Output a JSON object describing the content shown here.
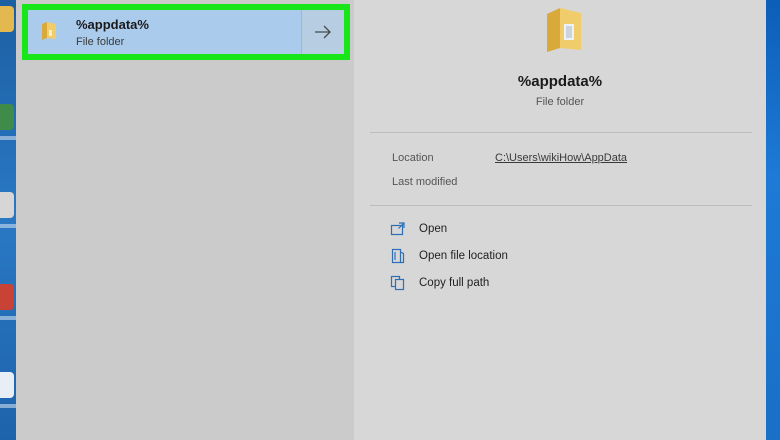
{
  "search_result": {
    "title": "%appdata%",
    "subtitle": "File folder"
  },
  "preview": {
    "title": "%appdata%",
    "subtitle": "File folder",
    "details": [
      {
        "label": "Location",
        "value": "C:\\Users\\wikiHow\\AppData"
      },
      {
        "label": "Last modified",
        "value": ""
      }
    ],
    "actions": [
      {
        "label": "Open",
        "icon": "open-icon"
      },
      {
        "label": "Open file location",
        "icon": "open-file-location-icon"
      },
      {
        "label": "Copy full path",
        "icon": "copy-full-path-icon"
      }
    ]
  },
  "colors": {
    "highlight_border": "#19e619",
    "result_background": "#abcbec",
    "accent_icon": "#2c6fb5",
    "folder_yellow": "#e8c25a"
  }
}
